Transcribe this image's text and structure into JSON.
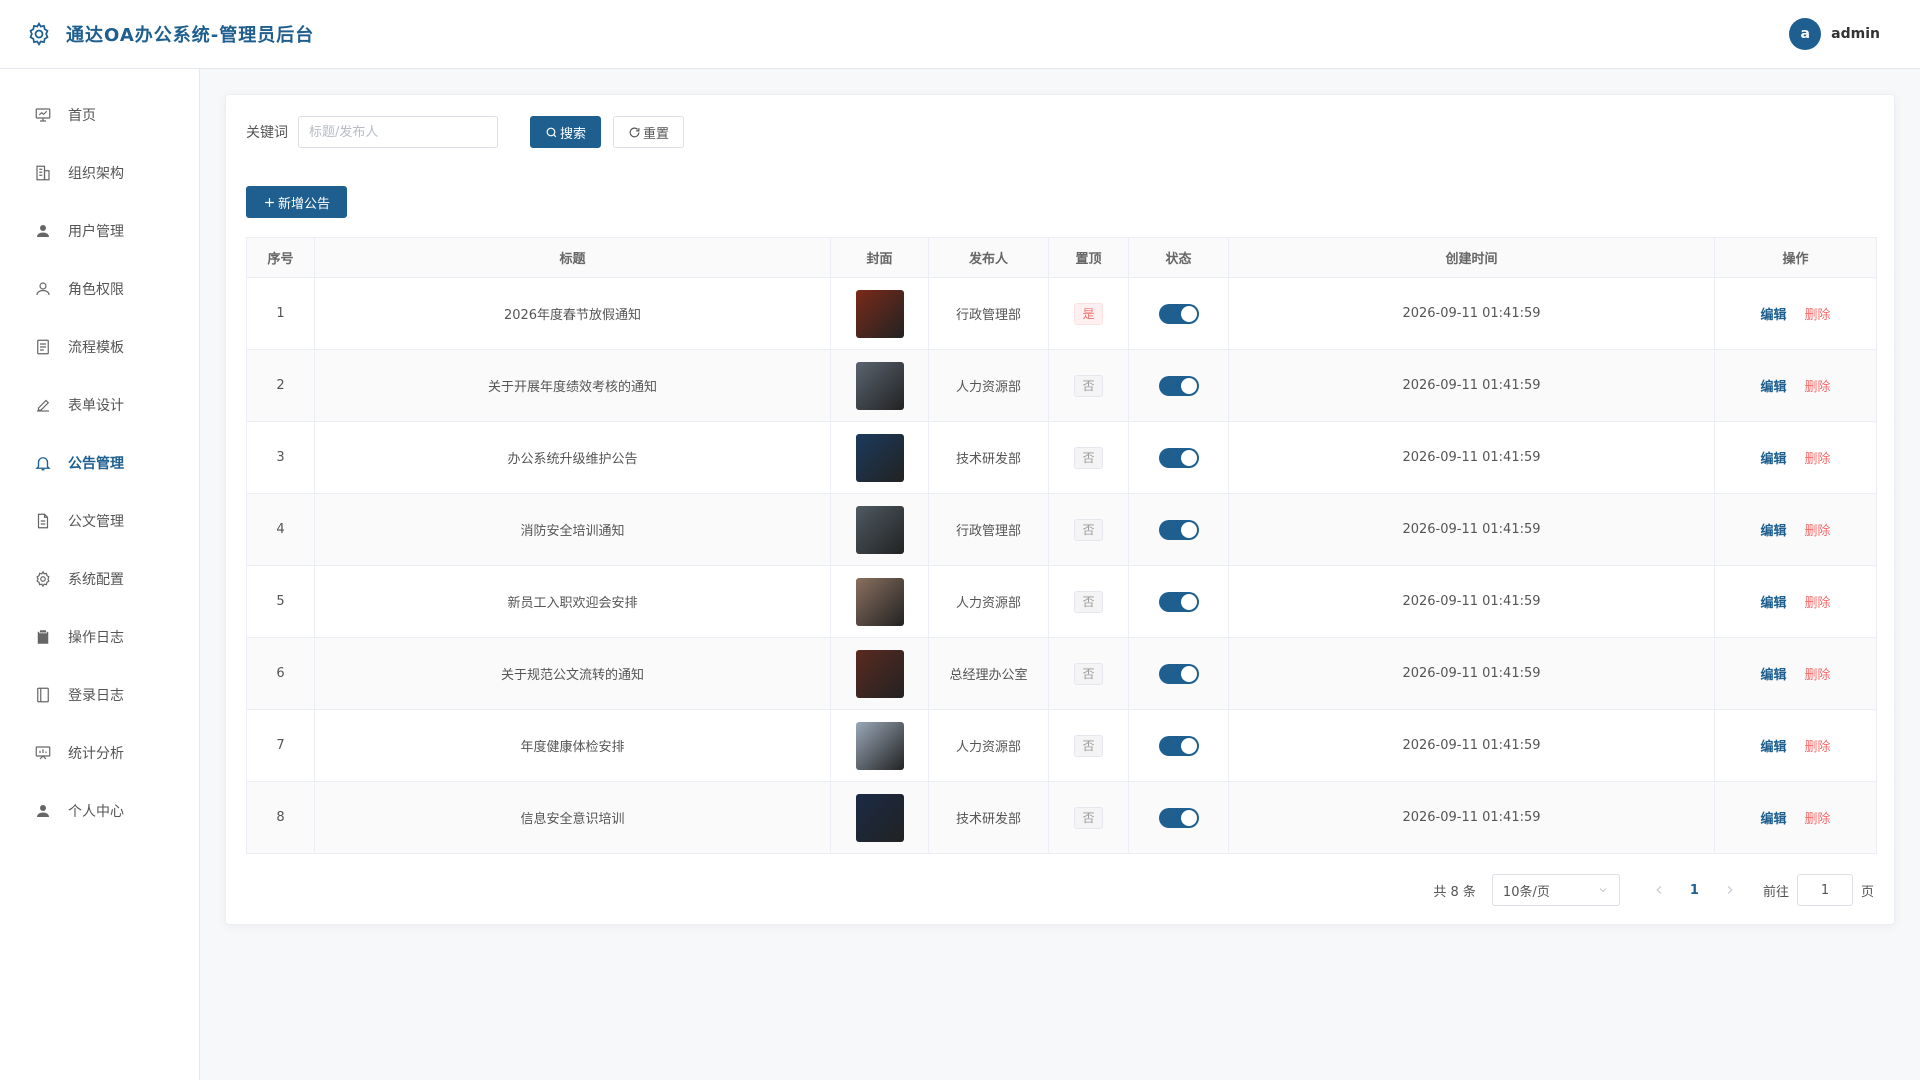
{
  "header": {
    "title": "通达OA办公系统-管理员后台",
    "avatar_letter": "a",
    "username": "admin"
  },
  "sidebar": {
    "items": [
      {
        "label": "首页",
        "icon": "monitor-icon"
      },
      {
        "label": "组织架构",
        "icon": "building-icon"
      },
      {
        "label": "用户管理",
        "icon": "user-filled-icon"
      },
      {
        "label": "角色权限",
        "icon": "user-outline-icon"
      },
      {
        "label": "流程模板",
        "icon": "document-icon"
      },
      {
        "label": "表单设计",
        "icon": "edit-pen-icon"
      },
      {
        "label": "公告管理",
        "icon": "bell-icon",
        "active": true
      },
      {
        "label": "公文管理",
        "icon": "file-icon"
      },
      {
        "label": "系统配置",
        "icon": "gear-icon"
      },
      {
        "label": "操作日志",
        "icon": "clipboard-icon"
      },
      {
        "label": "登录日志",
        "icon": "notebook-icon"
      },
      {
        "label": "统计分析",
        "icon": "chart-board-icon"
      },
      {
        "label": "个人中心",
        "icon": "user-filled-icon"
      }
    ]
  },
  "search": {
    "label": "关键词",
    "placeholder": "标题/发布人",
    "value": "",
    "search_label": "搜索",
    "reset_label": "重置"
  },
  "toolbar": {
    "add_label": "新增公告"
  },
  "table": {
    "columns": [
      "序号",
      "标题",
      "封面",
      "发布人",
      "置顶",
      "状态",
      "创建时间",
      "操作"
    ],
    "rows": [
      {
        "index": "1",
        "title": "2026年度春节放假通知",
        "publisher": "行政管理部",
        "pinned": "是",
        "pinned_flag": true,
        "enabled": true,
        "created": "2026-09-11 01:41:59",
        "cover_color": "#7a2a1a"
      },
      {
        "index": "2",
        "title": "关于开展年度绩效考核的通知",
        "publisher": "人力资源部",
        "pinned": "否",
        "pinned_flag": false,
        "enabled": true,
        "created": "2026-09-11 01:41:59",
        "cover_color": "#5a6470"
      },
      {
        "index": "3",
        "title": "办公系统升级维护公告",
        "publisher": "技术研发部",
        "pinned": "否",
        "pinned_flag": false,
        "enabled": true,
        "created": "2026-09-11 01:41:59",
        "cover_color": "#1b3a5c"
      },
      {
        "index": "4",
        "title": "消防安全培训通知",
        "publisher": "行政管理部",
        "pinned": "否",
        "pinned_flag": false,
        "enabled": true,
        "created": "2026-09-11 01:41:59",
        "cover_color": "#4e5a62"
      },
      {
        "index": "5",
        "title": "新员工入职欢迎会安排",
        "publisher": "人力资源部",
        "pinned": "否",
        "pinned_flag": false,
        "enabled": true,
        "created": "2026-09-11 01:41:59",
        "cover_color": "#8a7060"
      },
      {
        "index": "6",
        "title": "关于规范公文流转的通知",
        "publisher": "总经理办公室",
        "pinned": "否",
        "pinned_flag": false,
        "enabled": true,
        "created": "2026-09-11 01:41:59",
        "cover_color": "#5a2a20"
      },
      {
        "index": "7",
        "title": "年度健康体检安排",
        "publisher": "人力资源部",
        "pinned": "否",
        "pinned_flag": false,
        "enabled": true,
        "created": "2026-09-11 01:41:59",
        "cover_color": "#9aa8b8"
      },
      {
        "index": "8",
        "title": "信息安全意识培训",
        "publisher": "技术研发部",
        "pinned": "否",
        "pinned_flag": false,
        "enabled": true,
        "created": "2026-09-11 01:41:59",
        "cover_color": "#1a2a45"
      }
    ],
    "edit_label": "编辑",
    "delete_label": "删除"
  },
  "pagination": {
    "total": "共 8 条",
    "page_size": "10条/页",
    "current_page": "1",
    "goto_label": "前往",
    "goto_value": "1",
    "unit": "页"
  },
  "colors": {
    "primary": "#1e5f8f",
    "danger": "#f56c6c"
  }
}
